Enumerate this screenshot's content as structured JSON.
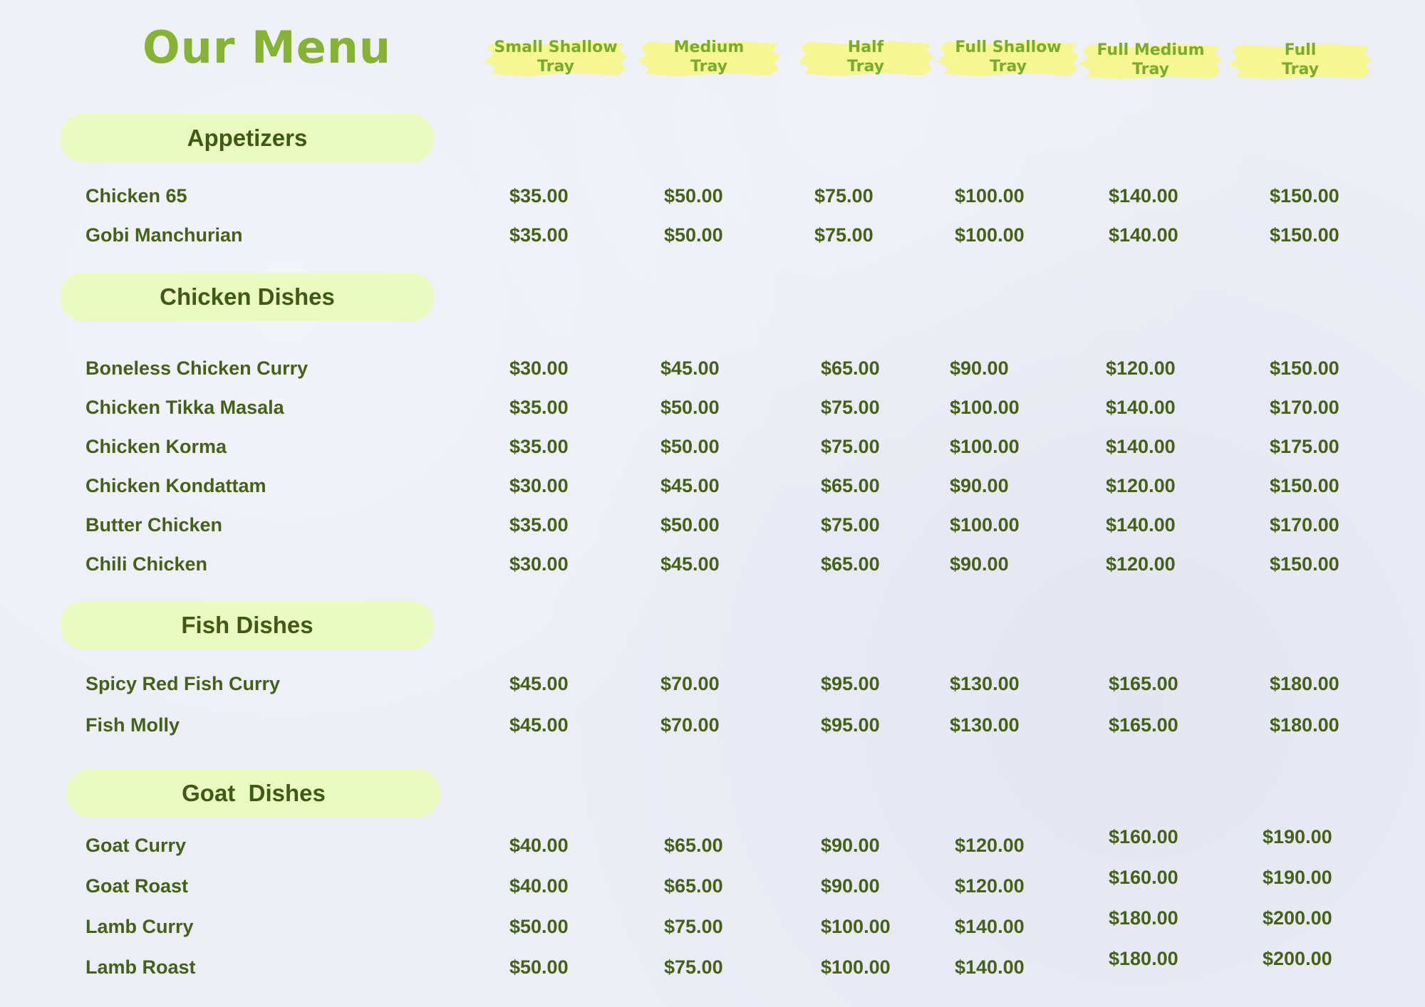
{
  "title": "Our Menu",
  "columns": [
    {
      "label": "Small Shallow\nTray"
    },
    {
      "label": "Medium\nTray"
    },
    {
      "label": "Half\nTray"
    },
    {
      "label": "Full Shallow\nTray"
    },
    {
      "label": "Full Medium\nTray"
    },
    {
      "label": "Full\nTray"
    }
  ],
  "colors": {
    "title": "#86b236",
    "header_text": "#7aab2e",
    "header_highlight": "#f6f78a",
    "section_bg": "#eafac0",
    "text": "#45601a",
    "page_bg": "#eceef6"
  },
  "sections": [
    {
      "title": "Appetizers",
      "items": [
        {
          "name": "Chicken 65",
          "prices": [
            "$35.00",
            "$50.00",
            "$75.00",
            "$100.00",
            "$140.00",
            "$150.00"
          ]
        },
        {
          "name": "Gobi Manchurian",
          "prices": [
            "$35.00",
            "$50.00",
            "$75.00",
            "$100.00",
            "$140.00",
            "$150.00"
          ]
        }
      ]
    },
    {
      "title": "Chicken Dishes",
      "items": [
        {
          "name": "Boneless Chicken Curry",
          "prices": [
            "$30.00",
            "$45.00",
            "$65.00",
            "$90.00",
            "$120.00",
            "$150.00"
          ]
        },
        {
          "name": "Chicken Tikka Masala",
          "prices": [
            "$35.00",
            "$50.00",
            "$75.00",
            "$100.00",
            "$140.00",
            "$170.00"
          ]
        },
        {
          "name": "Chicken Korma",
          "prices": [
            "$35.00",
            "$50.00",
            "$75.00",
            "$100.00",
            "$140.00",
            "$175.00"
          ]
        },
        {
          "name": "Chicken Kondattam",
          "prices": [
            "$30.00",
            "$45.00",
            "$65.00",
            "$90.00",
            "$120.00",
            "$150.00"
          ]
        },
        {
          "name": "Butter Chicken",
          "prices": [
            "$35.00",
            "$50.00",
            "$75.00",
            "$100.00",
            "$140.00",
            "$170.00"
          ]
        },
        {
          "name": "Chili Chicken",
          "prices": [
            "$30.00",
            "$45.00",
            "$65.00",
            "$90.00",
            "$120.00",
            "$150.00"
          ]
        }
      ]
    },
    {
      "title": "Fish Dishes",
      "items": [
        {
          "name": "Spicy Red Fish Curry",
          "prices": [
            "$45.00",
            "$70.00",
            "$95.00",
            "$130.00",
            "$165.00",
            "$180.00"
          ]
        },
        {
          "name": "Fish Molly",
          "prices": [
            "$45.00",
            "$70.00",
            "$95.00",
            "$130.00",
            "$165.00",
            "$180.00"
          ]
        }
      ]
    },
    {
      "title": "Goat  Dishes",
      "items": [
        {
          "name": "Goat Curry",
          "prices": [
            "$40.00",
            "$65.00",
            "$90.00",
            "$120.00",
            "$160.00",
            "$190.00"
          ]
        },
        {
          "name": "Goat Roast",
          "prices": [
            "$40.00",
            "$65.00",
            "$90.00",
            "$120.00",
            "$160.00",
            "$190.00"
          ]
        },
        {
          "name": "Lamb Curry",
          "prices": [
            "$50.00",
            "$75.00",
            "$100.00",
            "$140.00",
            "$180.00",
            "$200.00"
          ]
        },
        {
          "name": "Lamb Roast",
          "prices": [
            "$50.00",
            "$75.00",
            "$100.00",
            "$140.00",
            "$180.00",
            "$200.00"
          ]
        }
      ]
    }
  ]
}
